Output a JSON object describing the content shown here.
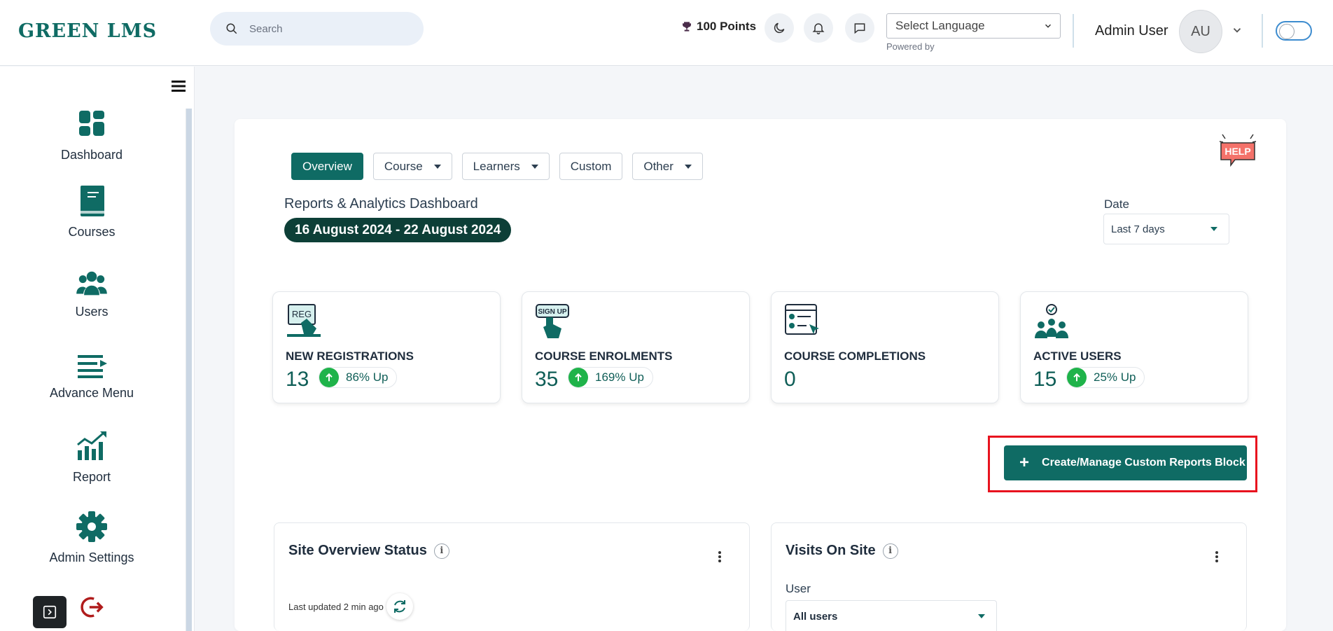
{
  "header": {
    "logo_text_green": "GREEN L",
    "logo_text_lms": "MS",
    "search_placeholder": "Search",
    "points": "100 Points",
    "language_placeholder": "Select Language",
    "powered_by": "Powered by",
    "user_name": "Admin User",
    "avatar_initials": "AU"
  },
  "sidebar": {
    "items": [
      {
        "label": "Dashboard",
        "icon": "dashboard-icon"
      },
      {
        "label": "Courses",
        "icon": "book-icon"
      },
      {
        "label": "Users",
        "icon": "users-icon"
      },
      {
        "label": "Advance Menu",
        "icon": "advance-menu-icon"
      },
      {
        "label": "Report",
        "icon": "report-icon"
      },
      {
        "label": "Admin Settings",
        "icon": "gear-icon"
      }
    ]
  },
  "main": {
    "tabs": [
      {
        "label": "Overview",
        "active": true,
        "dropdown": false
      },
      {
        "label": "Course",
        "dropdown": true
      },
      {
        "label": "Learners",
        "dropdown": true
      },
      {
        "label": "Custom",
        "dropdown": false
      },
      {
        "label": "Other",
        "dropdown": true
      }
    ],
    "help_label": "HELP",
    "title": "Reports & Analytics Dashboard",
    "date_range": "16 August 2024 - 22 August 2024",
    "date_label": "Date",
    "date_value": "Last 7 days",
    "stats": [
      {
        "name": "NEW REGISTRATIONS",
        "value": "13",
        "trend": "86% Up",
        "icon": "registration-icon"
      },
      {
        "name": "COURSE ENROLMENTS",
        "value": "35",
        "trend": "169% Up",
        "icon": "signup-icon"
      },
      {
        "name": "COURSE COMPLETIONS",
        "value": "0",
        "trend": "",
        "icon": "completion-icon"
      },
      {
        "name": "ACTIVE USERS",
        "value": "15",
        "trend": "25% Up",
        "icon": "active-users-icon"
      }
    ],
    "create_button": "Create/Manage Custom Reports Block",
    "site_overview": {
      "title": "Site Overview Status",
      "updated": "Last updated 2 min ago"
    },
    "visits": {
      "title": "Visits On Site",
      "user_label": "User",
      "user_value": "All users"
    }
  },
  "colors": {
    "brand": "#0f6b64",
    "date_pill": "#0d3f37",
    "trend_up": "#1fb34a",
    "highlight": "#e8131f"
  }
}
